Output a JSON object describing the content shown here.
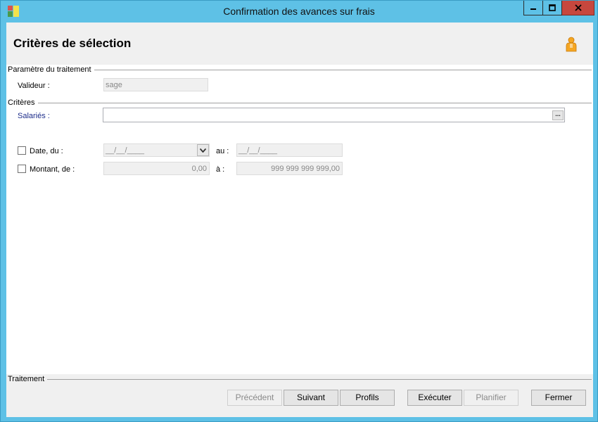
{
  "window": {
    "title": "Confirmation des avances sur frais"
  },
  "header": {
    "title": "Critères de sélection"
  },
  "parametre": {
    "section_label": "Paramètre du traitement",
    "valideur_label": "Valideur :",
    "valideur_value": "sage"
  },
  "criteres": {
    "section_label": "Critères",
    "salaries_label": "Salariés :",
    "salaries_value": "",
    "ellipsis": "...",
    "date_label": "Date, du :",
    "date_from_value": "__/__/____",
    "date_to_label": "au :",
    "date_to_value": "__/__/____",
    "montant_label": "Montant, de :",
    "montant_from_value": "0,00",
    "montant_to_label": "à :",
    "montant_to_value": "999 999 999 999,00"
  },
  "traitement": {
    "section_label": "Traitement",
    "buttons": {
      "precedent": "Précédent",
      "suivant": "Suivant",
      "profils": "Profils",
      "executer": "Exécuter",
      "planifier": "Planifier",
      "fermer": "Fermer"
    }
  },
  "colors": {
    "titlebar": "#5ec1e6",
    "close_button": "#c7473e",
    "label_blue": "#1c2c8a",
    "user_icon": "#f5a623"
  },
  "icons": {
    "app": "app-icon",
    "user": "user-icon",
    "minimize": "minimize-icon",
    "maximize": "maximize-icon",
    "close": "close-icon",
    "dropdown": "chevron-down-icon"
  }
}
